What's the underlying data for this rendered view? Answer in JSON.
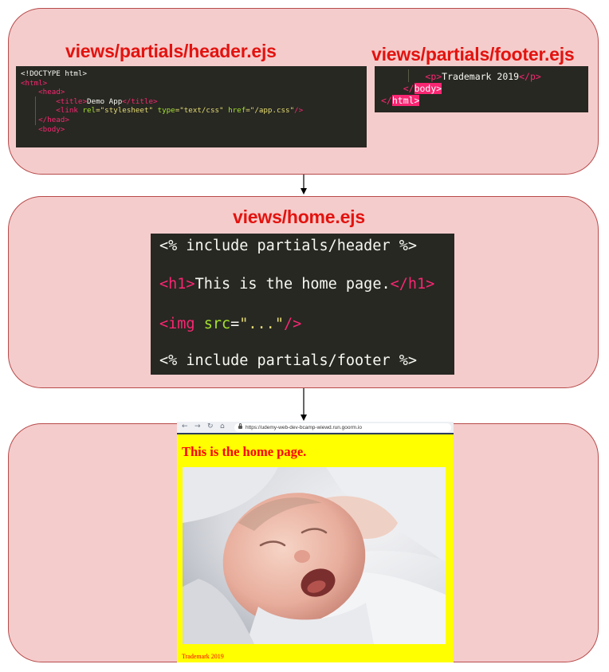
{
  "partials": {
    "header_heading": "views/partials/header.ejs",
    "footer_heading": "views/partials/footer.ejs",
    "header_code": {
      "doctype": "<!DOCTYPE html>",
      "html_open": "<html>",
      "head_open": "<head>",
      "title_open": "<title>",
      "title_text": "Demo App",
      "title_close": "</title>",
      "link_open": "<link",
      "rel_attr": "rel",
      "rel_val": "=\"stylesheet\"",
      "type_attr": "type",
      "type_val": "=\"text/css\"",
      "href_attr": "href",
      "href_val": "=\"/app.css\"",
      "link_close": "/>",
      "head_close": "</head>",
      "body_open": "<body>"
    },
    "footer_code": {
      "p_open": "<p>",
      "p_text": "Trademark 2019",
      "p_close": "</p>",
      "body_lt": "</",
      "body_tag": "body>",
      "html_lt": "</",
      "html_tag": "html>"
    }
  },
  "home": {
    "heading": "views/home.ejs",
    "line1": "<% include partials/header %>",
    "h1_open": "<h1>",
    "h1_text": "This is the home page.",
    "h1_close": "</h1>",
    "img_open": "<img",
    "img_attr": "src",
    "img_eq": "=",
    "img_val": "\"...\"",
    "img_close": "/>",
    "line4": "<% include partials/footer %>"
  },
  "browser": {
    "url": "https://udemy-web-dev-bcamp-wiewd.run.goorm.io",
    "page_title": "This is the home page.",
    "footer_text": "Trademark 2019",
    "photo_subject": "sleeping-yawning-baby"
  },
  "colors": {
    "panel_fill": "#f5cccc",
    "panel_border": "#b84a4a",
    "heading_red": "#e3130f",
    "code_bg": "#272822",
    "tag_pink": "#f92672",
    "attr_green": "#a6e22e",
    "string_yellow": "#e6db74",
    "browser_bg": "#ffff00"
  }
}
